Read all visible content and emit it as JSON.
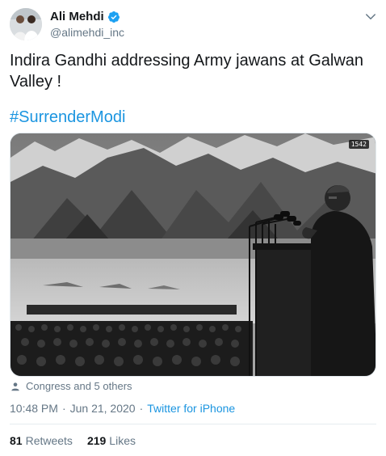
{
  "author": {
    "display_name": "Ali Mehdi",
    "handle": "@alimehdi_inc",
    "verified": true
  },
  "tweet": {
    "text": "Indira Gandhi addressing Army jawans at Galwan Valley !",
    "hashtag": "#SurrenderModi"
  },
  "media": {
    "badge": "1542",
    "description": "Black and white photo: a speaker at a podium with microphones addresses rows of seated soldiers in a mountain valley"
  },
  "tagged": {
    "text": "Congress and 5 others"
  },
  "meta": {
    "time": "10:48 PM",
    "separator": "·",
    "date": "Jun 21, 2020",
    "source": "Twitter for iPhone"
  },
  "stats": {
    "retweets_count": "81",
    "retweets_label": "Retweets",
    "likes_count": "219",
    "likes_label": "Likes"
  },
  "colors": {
    "link": "#1b95e0",
    "secondary_text": "#657786",
    "primary_text": "#14171a",
    "verified_badge": "#1da1f2"
  }
}
